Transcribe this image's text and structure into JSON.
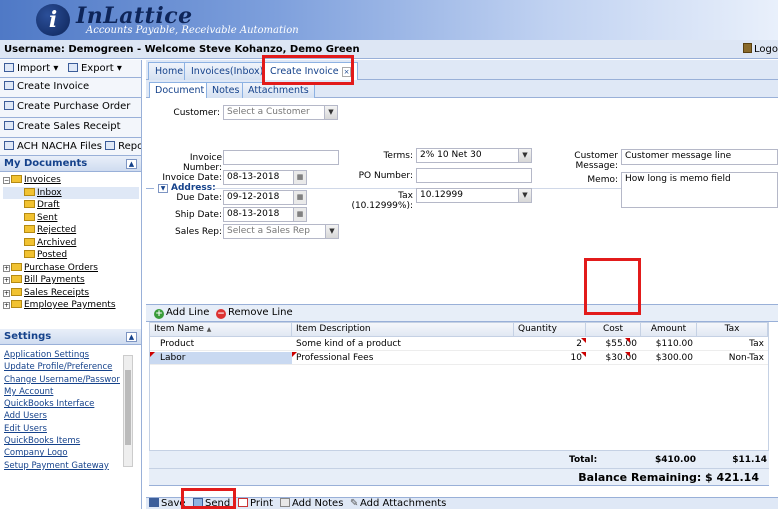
{
  "brand": {
    "logo_letter": "i",
    "name": "InLattice",
    "tagline": "Accounts Payable, Receivable Automation"
  },
  "userbar": {
    "text": "Username: Demogreen - Welcome Steve Kohanzo, Demo Green",
    "logout": "Logo"
  },
  "left": {
    "toolbar": {
      "import": "Import",
      "export": "Export"
    },
    "actions": [
      "Create Invoice",
      "Create Purchase Order",
      "Create Sales Receipt"
    ],
    "ach": "ACH NACHA Files",
    "reports": "Reports",
    "documents_title": "My Documents",
    "tree": {
      "invoices": "Invoices",
      "invoice_children": [
        "Inbox",
        "Draft",
        "Sent",
        "Rejected",
        "Archived",
        "Posted"
      ],
      "others": [
        "Purchase Orders",
        "Bill Payments",
        "Sales Receipts",
        "Employee Payments"
      ]
    },
    "settings_title": "Settings",
    "settings_links": [
      "Application Settings",
      "Update Profile/Preference",
      "Change Username/Password",
      "My Account",
      "QuickBooks Interface",
      "Add Users",
      "Edit Users",
      "QuickBooks Items",
      "Company Logo",
      "Setup Payment Gateway"
    ]
  },
  "tabs": [
    "Home",
    "Invoices(Inbox)",
    "Create Invoice"
  ],
  "subtabs": [
    "Document",
    "Notes",
    "Attachments"
  ],
  "form": {
    "customer_label": "Customer:",
    "customer_placeholder": "Select a Customer",
    "address_label": "Address:",
    "invoice_number_label": "Invoice Number:",
    "invoice_number_value": "",
    "invoice_date_label": "Invoice Date:",
    "invoice_date_value": "08-13-2018",
    "due_date_label": "Due Date:",
    "due_date_value": "09-12-2018",
    "ship_date_label": "Ship Date:",
    "ship_date_value": "08-13-2018",
    "sales_rep_label": "Sales Rep:",
    "sales_rep_placeholder": "Select a Sales Rep",
    "terms_label": "Terms:",
    "terms_value": "2% 10 Net 30",
    "po_label": "PO Number:",
    "po_value": "",
    "tax_label": "Tax (10.12999%):",
    "tax_value": "10.12999",
    "customer_message_label": "Customer Message:",
    "customer_message_value": "Customer message line",
    "memo_label": "Memo:",
    "memo_value": "How long is memo field"
  },
  "lines": {
    "add": "Add Line",
    "remove": "Remove Line"
  },
  "grid": {
    "headers": [
      "Item Name",
      "Item Description",
      "Quantity",
      "Cost",
      "Amount",
      "Tax"
    ],
    "sort_indicator": "▲",
    "rows": [
      {
        "item": "Product",
        "description": "Some kind of a product",
        "quantity": "2",
        "cost": "$55.00",
        "amount": "$110.00",
        "tax": "Tax"
      },
      {
        "item": "Labor",
        "description": "Professional Fees",
        "quantity": "10",
        "cost": "$30.00",
        "amount": "$300.00",
        "tax": "Non-Tax"
      }
    ],
    "total_label": "Total:",
    "total_amount": "$410.00",
    "total_tax": "$11.14",
    "balance_label": "Balance Remaining: $ 421.14"
  },
  "footer": [
    "Save",
    "Send",
    "Print",
    "Add Notes",
    "Add Attachments"
  ],
  "colors": {
    "highlight": "#e21b1b",
    "header_blue": "#4f79c6",
    "panel_blue": "#dfe8f6"
  }
}
